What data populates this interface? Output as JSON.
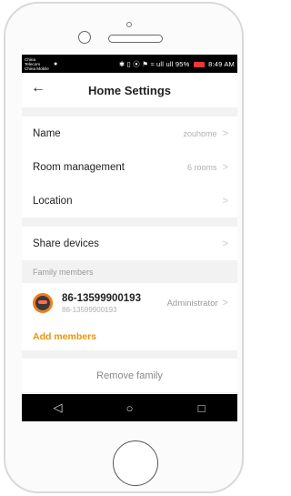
{
  "status_bar": {
    "carrier_1": "China Telecom",
    "carrier_2": "China Mobile",
    "icons": "✱ ▯ ⦿ ⚑ ≈ ull ull",
    "battery": "95%",
    "time": "8:49 AM"
  },
  "header": {
    "title": "Home Settings",
    "back_icon": "←"
  },
  "settings": {
    "name_label": "Name",
    "name_value": "zouhome",
    "room_label": "Room management",
    "room_value": "6 rooms",
    "location_label": "Location",
    "location_value": "",
    "share_label": "Share devices"
  },
  "family": {
    "section_label": "Family members",
    "members": [
      {
        "name": "86-13599900193",
        "subtitle": "86-13599900193",
        "role": "Administrator"
      }
    ],
    "add_label": "Add members"
  },
  "actions": {
    "remove_label": "Remove family"
  },
  "chevron": ">",
  "nav": {
    "back": "◁",
    "home": "○",
    "recent": "□"
  }
}
